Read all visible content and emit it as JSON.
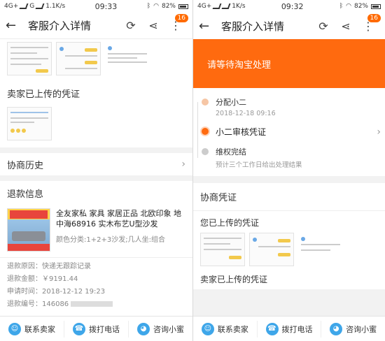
{
  "left": {
    "status": {
      "network": "4G+",
      "carrier": "G",
      "speed": "1.1K/s",
      "time": "09:33",
      "battery": "82%"
    },
    "header": {
      "title": "客服介入详情",
      "badge": "16"
    },
    "seller_evidence_title": "卖家已上传的凭证",
    "history_label": "协商历史",
    "refund_title": "退款信息",
    "product": {
      "name": "全友家私 家具 家居正品 北欧印象 地中海68916 实木布艺U型沙发",
      "spec": "颜色分类:1+2+3沙发;几人坐:组合"
    },
    "details": [
      {
        "k": "退款原因：",
        "v": "快递无跟踪记录"
      },
      {
        "k": "退款金额：",
        "v": "￥9191.44"
      },
      {
        "k": "申请时间：",
        "v": "2018-12-12 19:23"
      },
      {
        "k": "退款编号：",
        "v": "146086"
      }
    ]
  },
  "right": {
    "status": {
      "network": "4G+",
      "carrier": "",
      "speed": "1K/s",
      "time": "09:32",
      "battery": "82%"
    },
    "header": {
      "title": "客服介入详情",
      "badge": "16"
    },
    "banner": "请等待淘宝处理",
    "timeline": [
      {
        "label": "分配小二",
        "sub": "2018-12-18 09:16",
        "state": "done"
      },
      {
        "label": "小二审核凭证",
        "sub": "",
        "state": "active"
      },
      {
        "label": "维权完结",
        "sub": "预计三个工作日给出处理结果",
        "state": "todo"
      }
    ],
    "evidence_title": "协商凭证",
    "mine_title": "您已上传的凭证",
    "seller_title": "卖家已上传的凭证"
  },
  "bottom": {
    "contact": "联系卖家",
    "call": "拨打电话",
    "ask": "咨询小蜜"
  },
  "colors": {
    "accent": "#ff6a0f",
    "icon_blue": "#3ea6e9"
  }
}
